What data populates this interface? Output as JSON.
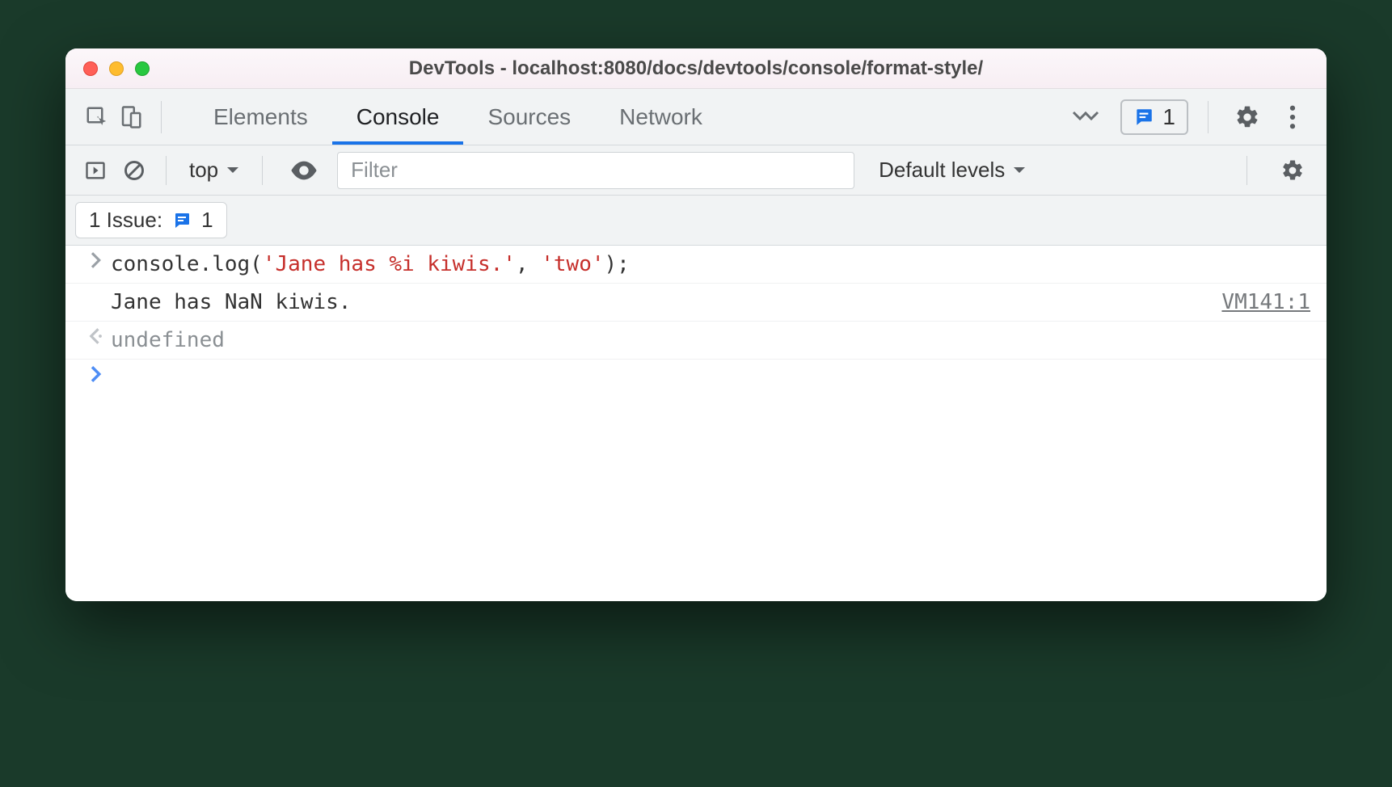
{
  "window": {
    "title": "DevTools - localhost:8080/docs/devtools/console/format-style/"
  },
  "tabs": {
    "elements": "Elements",
    "console": "Console",
    "sources": "Sources",
    "network": "Network"
  },
  "issues_badge": {
    "count": "1"
  },
  "toolbar": {
    "context": "top",
    "filter_placeholder": "Filter",
    "levels": "Default levels"
  },
  "issue_row": {
    "prefix": "1 Issue:",
    "count": "1"
  },
  "console": {
    "input_prefix": "console.log(",
    "string1": "'Jane has %i kiwis.'",
    "sep": ", ",
    "string2": "'two'",
    "input_suffix": ");",
    "output": "Jane has NaN kiwis.",
    "source": "VM141:1",
    "return": "undefined"
  }
}
